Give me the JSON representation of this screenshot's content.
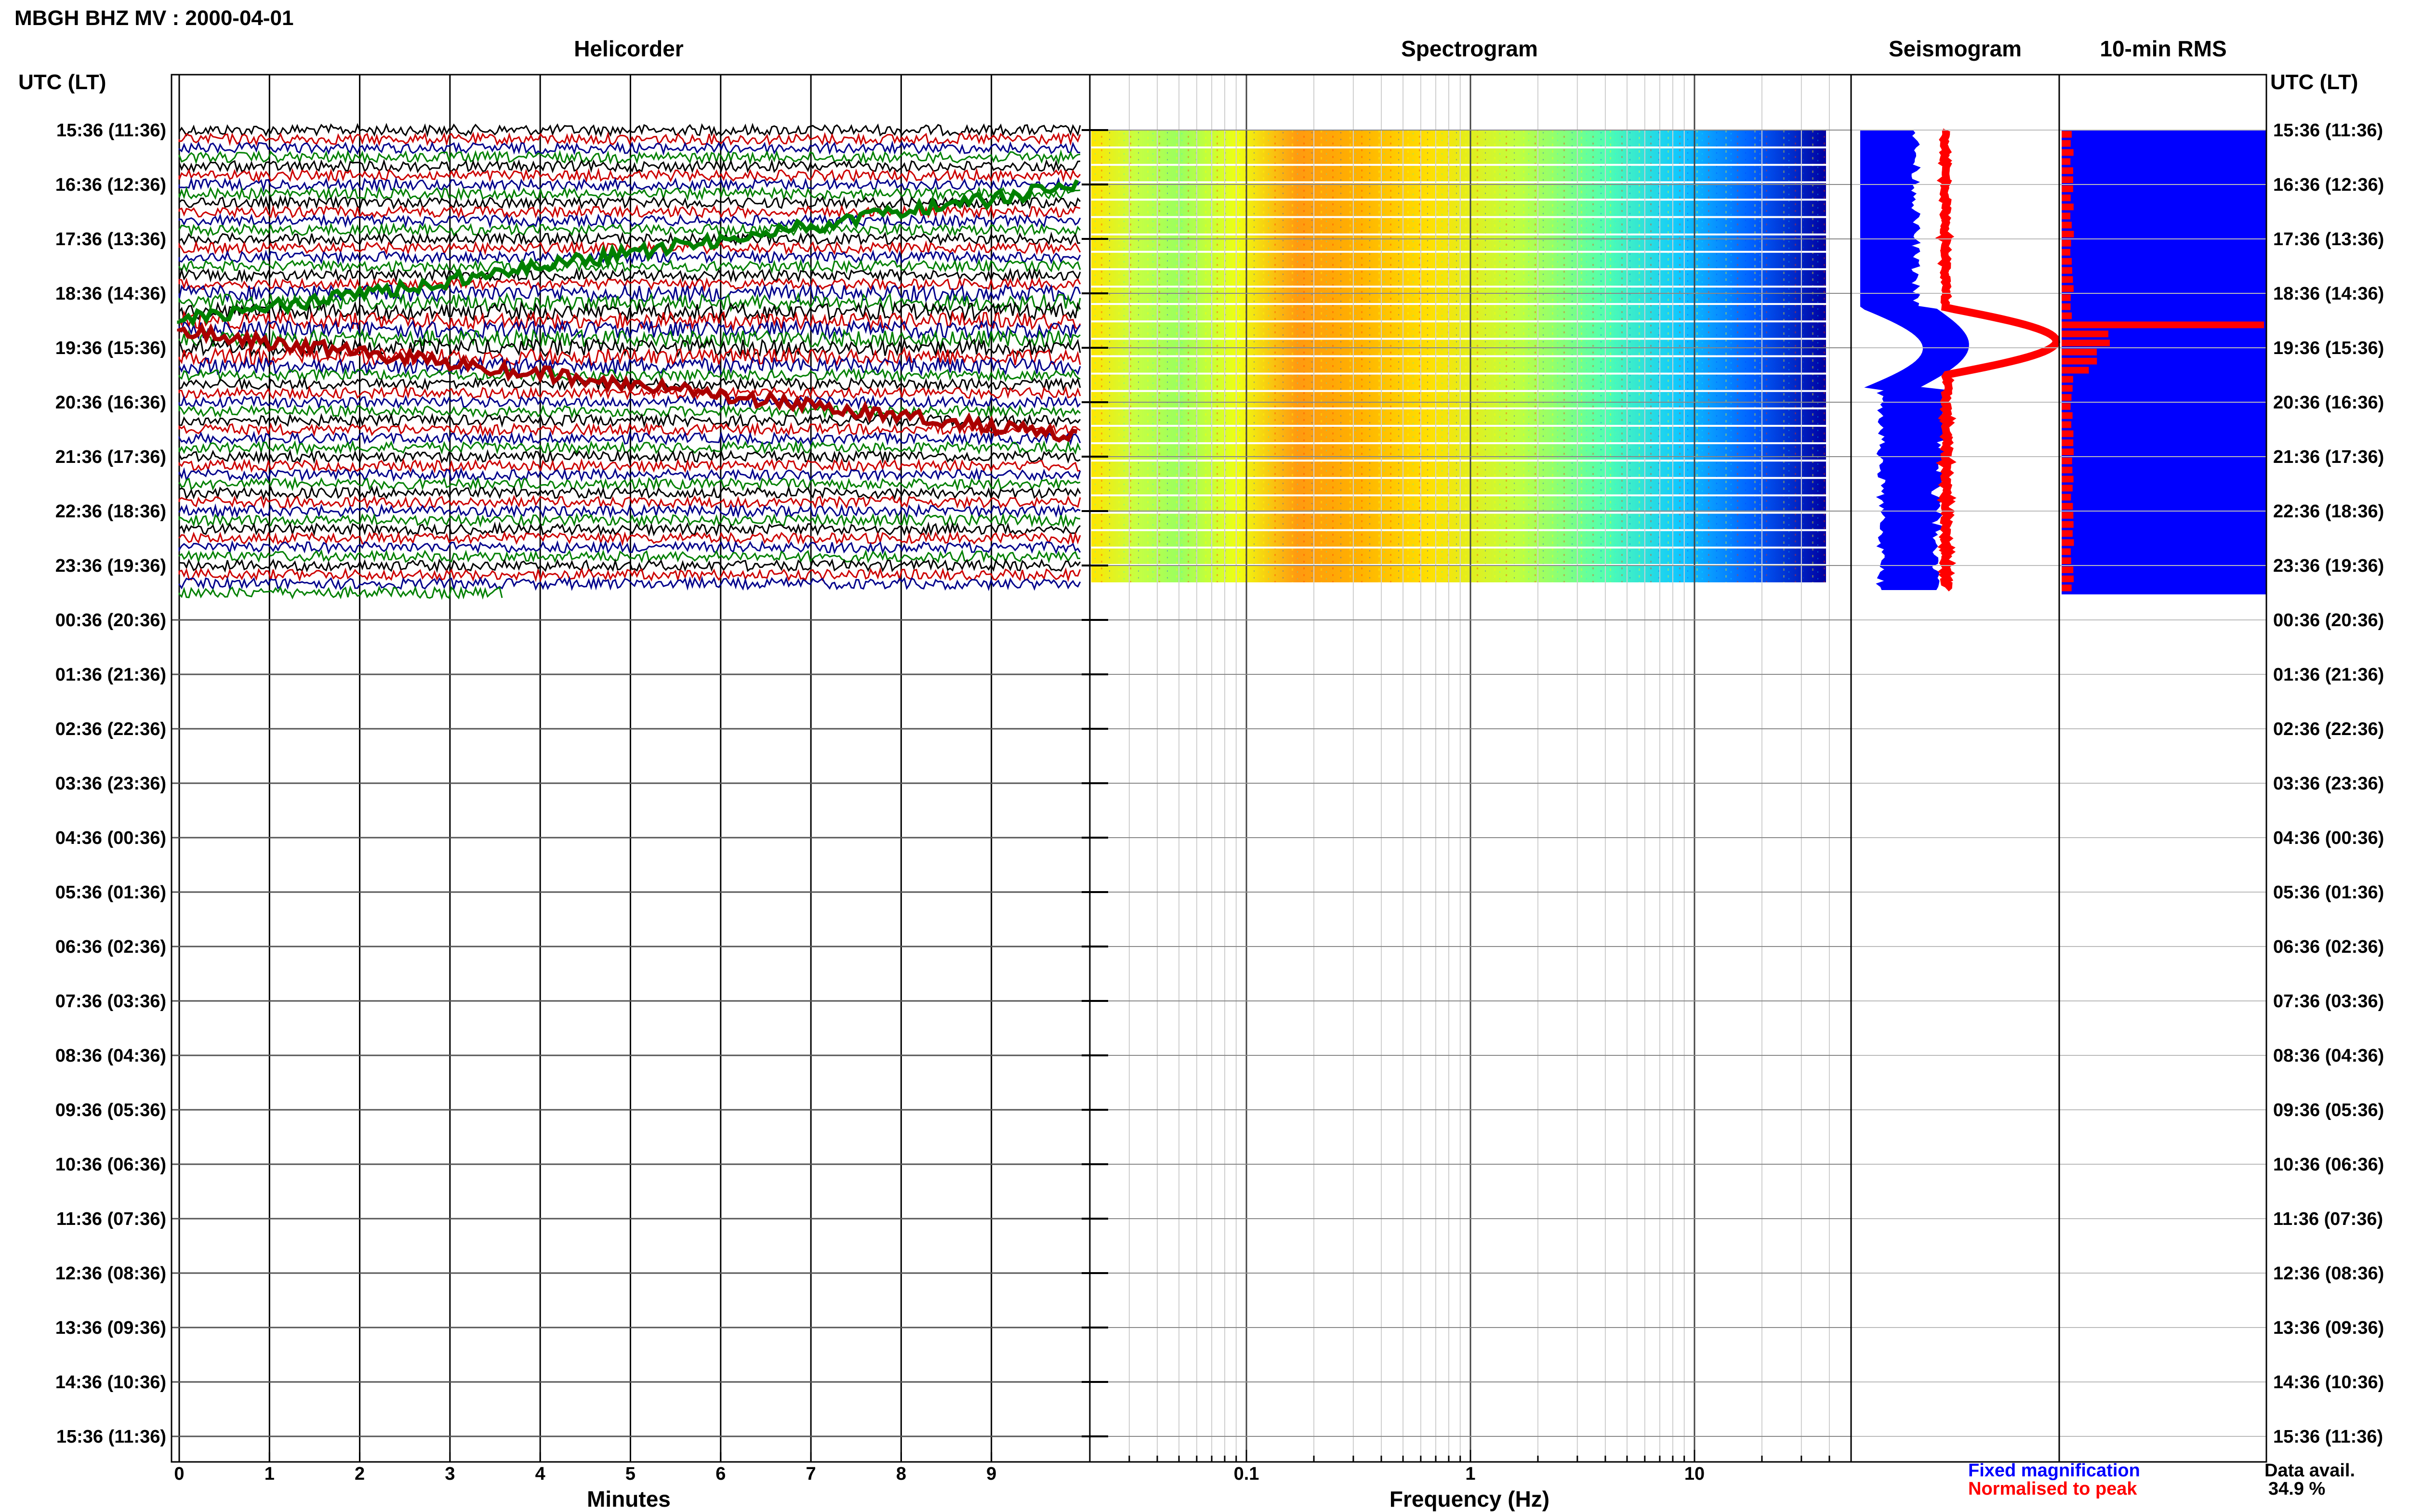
{
  "header": {
    "title": "MBGH BHZ MV : 2000-04-01",
    "utc_left": "UTC (LT)",
    "utc_right": "UTC (LT)"
  },
  "panels": {
    "helicorder": "Helicorder",
    "spectrogram": "Spectrogram",
    "seismogram": "Seismogram",
    "rms": "10-min RMS"
  },
  "time_labels": [
    "15:36 (11:36)",
    "16:36 (12:36)",
    "17:36 (13:36)",
    "18:36 (14:36)",
    "19:36 (15:36)",
    "20:36 (16:36)",
    "21:36 (17:36)",
    "22:36 (18:36)",
    "23:36 (19:36)",
    "00:36 (20:36)",
    "01:36 (21:36)",
    "02:36 (22:36)",
    "03:36 (23:36)",
    "04:36 (00:36)",
    "05:36 (01:36)",
    "06:36 (02:36)",
    "07:36 (03:36)",
    "08:36 (04:36)",
    "09:36 (05:36)",
    "10:36 (06:36)",
    "11:36 (07:36)",
    "12:36 (08:36)",
    "13:36 (09:36)",
    "14:36 (10:36)",
    "15:36 (11:36)"
  ],
  "legend": {
    "fixed": "Fixed magnification",
    "normalised": "Normalised to peak",
    "fixed_color": "#0000ff",
    "normalised_color": "#ff0000"
  },
  "availability": {
    "label": "Data avail.",
    "value": "34.9 %"
  },
  "chart_data": [
    {
      "type": "line",
      "title": "Helicorder",
      "xlabel": "Minutes",
      "x_ticks": [
        "0",
        "1",
        "2",
        "3",
        "4",
        "5",
        "6",
        "7",
        "8",
        "9"
      ],
      "xlim": [
        0,
        10
      ],
      "trace_colors": [
        "#000000",
        "#cc0000",
        "#00008b",
        "#008000"
      ],
      "colors_note": "traces cycle black, dark red, blue, green",
      "rows_with_data_hours": 8.5
    },
    {
      "type": "heatmap",
      "title": "Spectrogram",
      "xlabel": "Frequency (Hz)",
      "x_ticks": [
        "0.1",
        "1",
        "10"
      ],
      "xscale": "log",
      "xlim": [
        0.02,
        50
      ],
      "colormap": [
        "#00008f",
        "#0050ff",
        "#00d0ff",
        "#80ff80",
        "#ffff00",
        "#ff8000",
        "#c00000"
      ]
    },
    {
      "type": "line",
      "title": "Seismogram",
      "series": [
        {
          "name": "Fixed magnification",
          "color": "#0000ff"
        },
        {
          "name": "Normalised to peak",
          "color": "#ff0000"
        }
      ]
    },
    {
      "type": "bar",
      "title": "10-min RMS",
      "bar_color": "#ff0000",
      "background_color": "#0000ff",
      "peak_hour_offset": 3.35
    }
  ]
}
